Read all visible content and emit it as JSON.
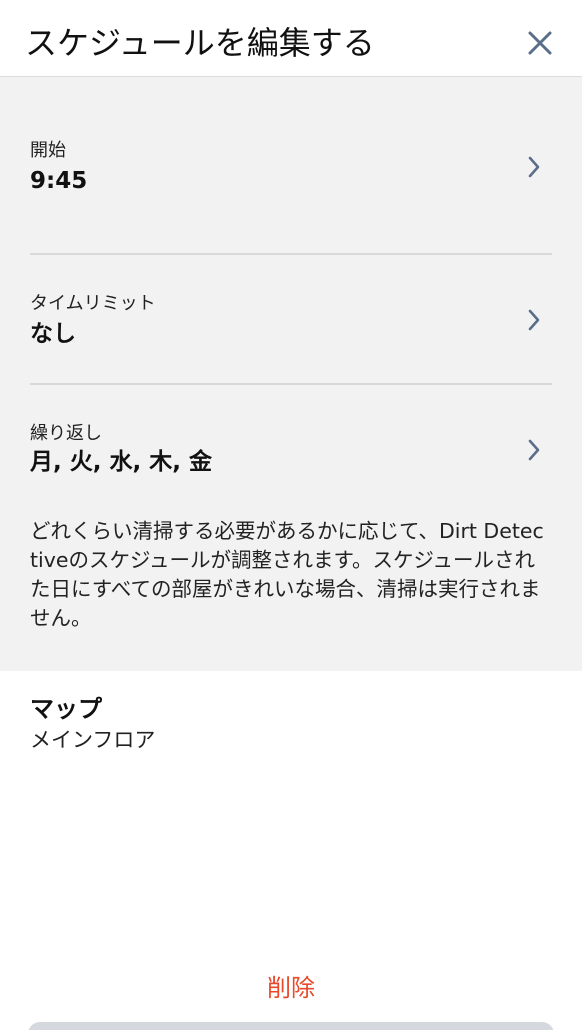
{
  "header": {
    "title": "スケジュールを編集する",
    "close_icon": "close-icon"
  },
  "settings": {
    "start": {
      "label": "開始",
      "value": "9:45"
    },
    "time_limit": {
      "label": "タイムリミット",
      "value": "なし"
    },
    "repeat": {
      "label": "繰り返し",
      "value": "月, 火, 水, 木, 金"
    },
    "description": "どれくらい清掃する必要があるかに応じて、Dirt Detectiveのスケジュールが調整されます。スケジュールされた日にすべての部屋がきれいな場合、清掃は実行されません。"
  },
  "map": {
    "title": "マップ",
    "value": "メインフロア"
  },
  "actions": {
    "delete_label": "削除"
  },
  "colors": {
    "accent_delete": "#e8492a",
    "chevron": "#5a6e8c",
    "panel_background": "#f2f2f2"
  }
}
